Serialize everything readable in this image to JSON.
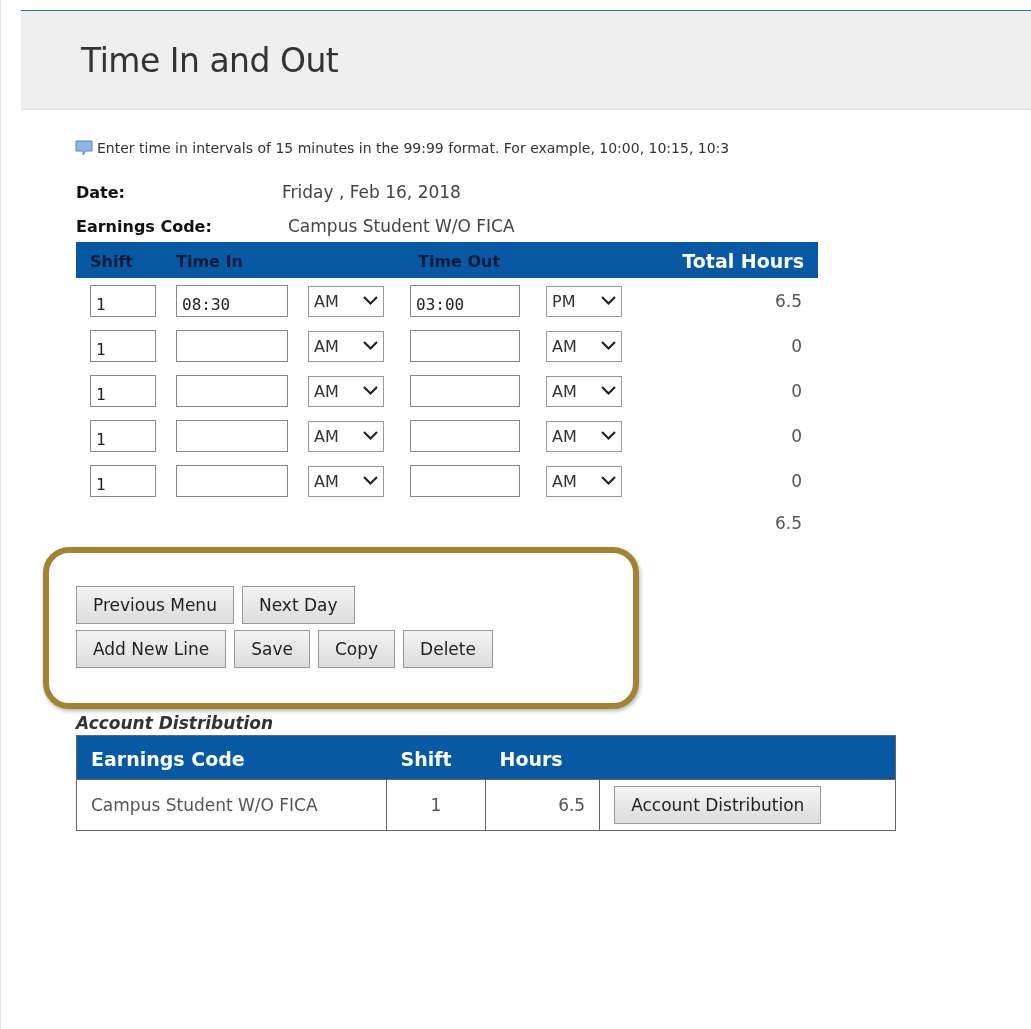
{
  "page_title": "Time In and Out",
  "hint": "Enter time in intervals of 15 minutes in the 99:99 format. For example, 10:00, 10:15, 10:3",
  "date": {
    "label": "Date:",
    "value": "Friday , Feb 16, 2018"
  },
  "earnings_code": {
    "label": "Earnings Code:",
    "value": "Campus Student W/O FICA"
  },
  "time_table": {
    "columns": [
      "Shift",
      "Time In",
      "Time Out",
      "Total Hours"
    ],
    "rows": [
      {
        "shift": "1",
        "time_in": "08:30",
        "in_period": "AM",
        "time_out": "03:00",
        "out_period": "PM",
        "total": "6.5"
      },
      {
        "shift": "1",
        "in_period": "AM",
        "out_period": "AM",
        "total": "0"
      },
      {
        "shift": "1",
        "in_period": "AM",
        "out_period": "AM",
        "total": "0"
      },
      {
        "shift": "1",
        "in_period": "AM",
        "out_period": "AM",
        "total": "0"
      },
      {
        "shift": "1",
        "in_period": "AM",
        "out_period": "AM",
        "total": "0"
      }
    ],
    "grand_total": "6.5"
  },
  "button_rows": [
    [
      "Previous Menu",
      "Next Day"
    ],
    [
      "Add New Line",
      "Save",
      "Copy",
      "Delete"
    ]
  ],
  "account_distribution": {
    "title": "Account Distribution",
    "columns": [
      "Earnings Code",
      "Shift",
      "Hours"
    ],
    "rows": [
      {
        "earnings_code": "Campus Student W/O FICA",
        "shift": "1",
        "hours": "6.5",
        "button": "Account Distribution"
      }
    ]
  }
}
